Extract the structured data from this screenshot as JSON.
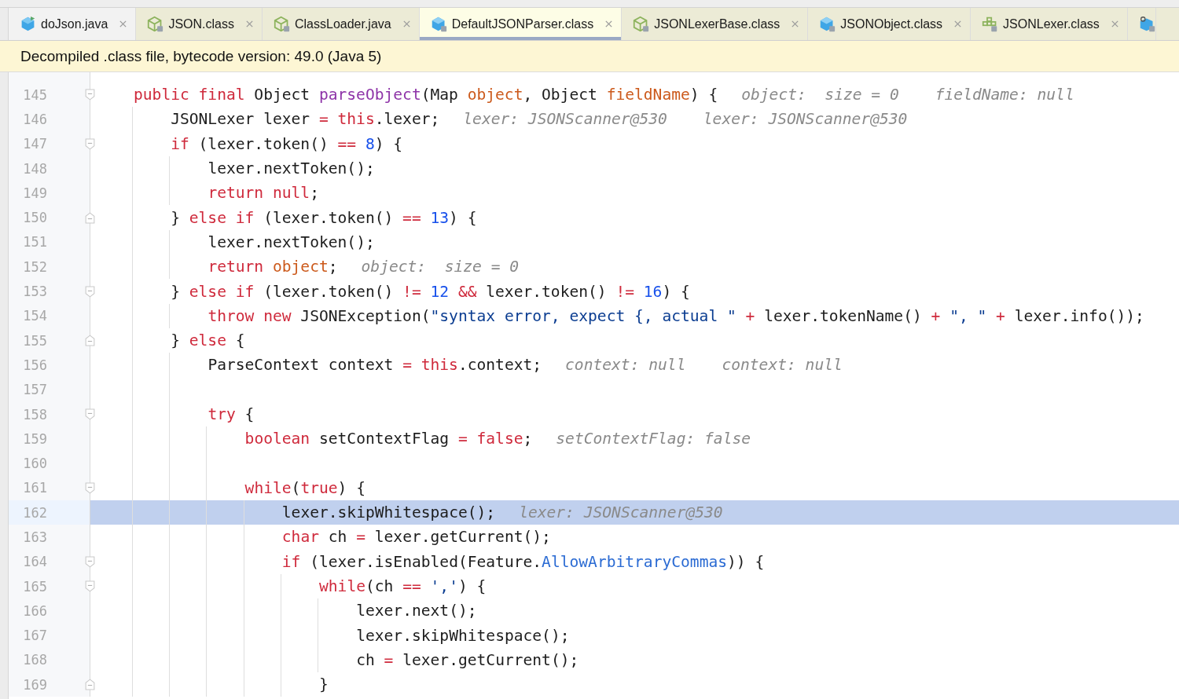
{
  "tabs": [
    {
      "label": "doJson.java",
      "kind": "java",
      "readonly": false,
      "selected": false
    },
    {
      "label": "JSON.class",
      "kind": "class",
      "readonly": true,
      "selected": false
    },
    {
      "label": "ClassLoader.java",
      "kind": "class",
      "readonly": true,
      "selected": false
    },
    {
      "label": "DefaultJSONParser.class",
      "kind": "class-blue",
      "readonly": true,
      "selected": true
    },
    {
      "label": "JSONLexerBase.class",
      "kind": "class",
      "readonly": true,
      "selected": false
    },
    {
      "label": "JSONObject.class",
      "kind": "class-blue",
      "readonly": true,
      "selected": false
    },
    {
      "label": "JSONLexer.class",
      "kind": "grid",
      "readonly": true,
      "selected": false
    },
    {
      "kind": "gear-cube",
      "readonly": true,
      "selected": false
    }
  ],
  "banner": "Decompiled .class file, bytecode version: 49.0 (Java 5)",
  "lines": [
    {
      "number": "145",
      "kind": "fold-start",
      "selected": false,
      "code": [
        {
          "text": "public final",
          "kind": "kw"
        },
        {
          "text": " Object ",
          "kind": "plain"
        },
        {
          "text": "parseObject",
          "kind": "decl"
        },
        {
          "text": "(Map ",
          "kind": "plain"
        },
        {
          "text": "object",
          "kind": "param"
        },
        {
          "text": ", Object ",
          "kind": "plain"
        },
        {
          "text": "fieldName",
          "kind": "param"
        },
        {
          "text": ") {",
          "kind": "plain"
        }
      ],
      "hints": [
        "object:  size = 0",
        "fieldName: null"
      ]
    },
    {
      "number": "146",
      "kind": "plain",
      "selected": false,
      "code": [
        {
          "text": "    JSONLexer lexer ",
          "kind": "plain"
        },
        {
          "text": "= ",
          "kind": "kw"
        },
        {
          "text": "this",
          "kind": "kw"
        },
        {
          "text": ".lexer;",
          "kind": "plain"
        }
      ],
      "hints": [
        "lexer: JSONScanner@530",
        "lexer: JSONScanner@530"
      ]
    },
    {
      "number": "147",
      "kind": "fold-start",
      "selected": false,
      "code": [
        {
          "text": "    if",
          "kind": "kw"
        },
        {
          "text": " (lexer.token() ",
          "kind": "plain"
        },
        {
          "text": "== ",
          "kind": "kw"
        },
        {
          "text": "8",
          "kind": "num"
        },
        {
          "text": ") {",
          "kind": "plain"
        }
      ]
    },
    {
      "number": "148",
      "kind": "plain",
      "selected": false,
      "code": [
        {
          "text": "        lexer.nextToken();",
          "kind": "plain"
        }
      ]
    },
    {
      "number": "149",
      "kind": "plain",
      "selected": false,
      "code": [
        {
          "text": "        return null",
          "kind": "kw"
        },
        {
          "text": ";",
          "kind": "plain"
        }
      ]
    },
    {
      "number": "150",
      "kind": "fold-end",
      "selected": false,
      "code": [
        {
          "text": "    } ",
          "kind": "plain"
        },
        {
          "text": "else if",
          "kind": "kw"
        },
        {
          "text": " (lexer.token() ",
          "kind": "plain"
        },
        {
          "text": "== ",
          "kind": "kw"
        },
        {
          "text": "13",
          "kind": "num"
        },
        {
          "text": ") {",
          "kind": "plain"
        }
      ]
    },
    {
      "number": "151",
      "kind": "plain",
      "selected": false,
      "code": [
        {
          "text": "        lexer.nextToken();",
          "kind": "plain"
        }
      ]
    },
    {
      "number": "152",
      "kind": "plain",
      "selected": false,
      "code": [
        {
          "text": "        return ",
          "kind": "kw"
        },
        {
          "text": "object",
          "kind": "param"
        },
        {
          "text": ";",
          "kind": "plain"
        }
      ],
      "hints": [
        "object:  size = 0"
      ]
    },
    {
      "number": "153",
      "kind": "fold-start",
      "selected": false,
      "code": [
        {
          "text": "    } ",
          "kind": "plain"
        },
        {
          "text": "else if",
          "kind": "kw"
        },
        {
          "text": " (lexer.token() ",
          "kind": "plain"
        },
        {
          "text": "!= ",
          "kind": "kw"
        },
        {
          "text": "12",
          "kind": "num"
        },
        {
          "text": " &&",
          "kind": "kw"
        },
        {
          "text": " lexer.token() ",
          "kind": "plain"
        },
        {
          "text": "!= ",
          "kind": "kw"
        },
        {
          "text": "16",
          "kind": "num"
        },
        {
          "text": ") {",
          "kind": "plain"
        }
      ]
    },
    {
      "number": "154",
      "kind": "plain",
      "selected": false,
      "code": [
        {
          "text": "        throw new",
          "kind": "kw"
        },
        {
          "text": " JSONException(",
          "kind": "plain"
        },
        {
          "text": "\"syntax error, expect {, actual \"",
          "kind": "str"
        },
        {
          "text": " +",
          "kind": "kw"
        },
        {
          "text": " lexer.tokenName() ",
          "kind": "plain"
        },
        {
          "text": "+ ",
          "kind": "kw"
        },
        {
          "text": "\", \"",
          "kind": "str"
        },
        {
          "text": " +",
          "kind": "kw"
        },
        {
          "text": " lexer.info());",
          "kind": "plain"
        }
      ]
    },
    {
      "number": "155",
      "kind": "fold-end",
      "selected": false,
      "code": [
        {
          "text": "    } ",
          "kind": "plain"
        },
        {
          "text": "else",
          "kind": "kw"
        },
        {
          "text": " {",
          "kind": "plain"
        }
      ]
    },
    {
      "number": "156",
      "kind": "plain",
      "selected": false,
      "code": [
        {
          "text": "        ParseContext context ",
          "kind": "plain"
        },
        {
          "text": "= ",
          "kind": "kw"
        },
        {
          "text": "this",
          "kind": "kw"
        },
        {
          "text": ".context;",
          "kind": "plain"
        }
      ],
      "hints": [
        "context: null",
        "context: null"
      ]
    },
    {
      "number": "157",
      "kind": "plain",
      "selected": false
    },
    {
      "number": "158",
      "kind": "fold-start",
      "selected": false,
      "code": [
        {
          "text": "        try",
          "kind": "kw"
        },
        {
          "text": " {",
          "kind": "plain"
        }
      ]
    },
    {
      "number": "159",
      "kind": "plain",
      "selected": false,
      "code": [
        {
          "text": "            boolean",
          "kind": "kw"
        },
        {
          "text": " setContextFlag ",
          "kind": "plain"
        },
        {
          "text": "= false",
          "kind": "kw"
        },
        {
          "text": ";",
          "kind": "plain"
        }
      ],
      "hints": [
        "setContextFlag: false"
      ]
    },
    {
      "number": "160",
      "kind": "plain",
      "selected": false
    },
    {
      "number": "161",
      "kind": "fold-start",
      "selected": false,
      "code": [
        {
          "text": "            while",
          "kind": "kw"
        },
        {
          "text": "(",
          "kind": "plain"
        },
        {
          "text": "true",
          "kind": "kw"
        },
        {
          "text": ") {",
          "kind": "plain"
        }
      ]
    },
    {
      "number": "162",
      "kind": "plain",
      "selected": true,
      "code": [
        {
          "text": "                lexer.skipWhitespace();",
          "kind": "plain"
        }
      ],
      "hints": [
        "lexer: JSONScanner@530"
      ]
    },
    {
      "number": "163",
      "kind": "plain",
      "selected": false,
      "code": [
        {
          "text": "                char",
          "kind": "kw"
        },
        {
          "text": " ch ",
          "kind": "plain"
        },
        {
          "text": "=",
          "kind": "kw"
        },
        {
          "text": " lexer.getCurrent();",
          "kind": "plain"
        }
      ]
    },
    {
      "number": "164",
      "kind": "fold-start",
      "selected": false,
      "code": [
        {
          "text": "                if",
          "kind": "kw"
        },
        {
          "text": " (lexer.isEnabled(Feature.",
          "kind": "plain"
        },
        {
          "text": "AllowArbitraryCommas",
          "kind": "const"
        },
        {
          "text": ")) {",
          "kind": "plain"
        }
      ]
    },
    {
      "number": "165",
      "kind": "fold-start",
      "selected": false,
      "code": [
        {
          "text": "                    while",
          "kind": "kw"
        },
        {
          "text": "(ch ",
          "kind": "plain"
        },
        {
          "text": "== ",
          "kind": "kw"
        },
        {
          "text": "','",
          "kind": "str"
        },
        {
          "text": ") {",
          "kind": "plain"
        }
      ]
    },
    {
      "number": "166",
      "kind": "plain",
      "selected": false,
      "code": [
        {
          "text": "                        lexer.next();",
          "kind": "plain"
        }
      ]
    },
    {
      "number": "167",
      "kind": "plain",
      "selected": false,
      "code": [
        {
          "text": "                        lexer.skipWhitespace();",
          "kind": "plain"
        }
      ]
    },
    {
      "number": "168",
      "kind": "plain",
      "selected": false,
      "code": [
        {
          "text": "                        ch ",
          "kind": "plain"
        },
        {
          "text": "=",
          "kind": "kw"
        },
        {
          "text": " lexer.getCurrent();",
          "kind": "plain"
        }
      ]
    },
    {
      "number": "169",
      "kind": "fold-end",
      "selected": false,
      "code": [
        {
          "text": "                    }",
          "kind": "plain"
        }
      ]
    }
  ]
}
